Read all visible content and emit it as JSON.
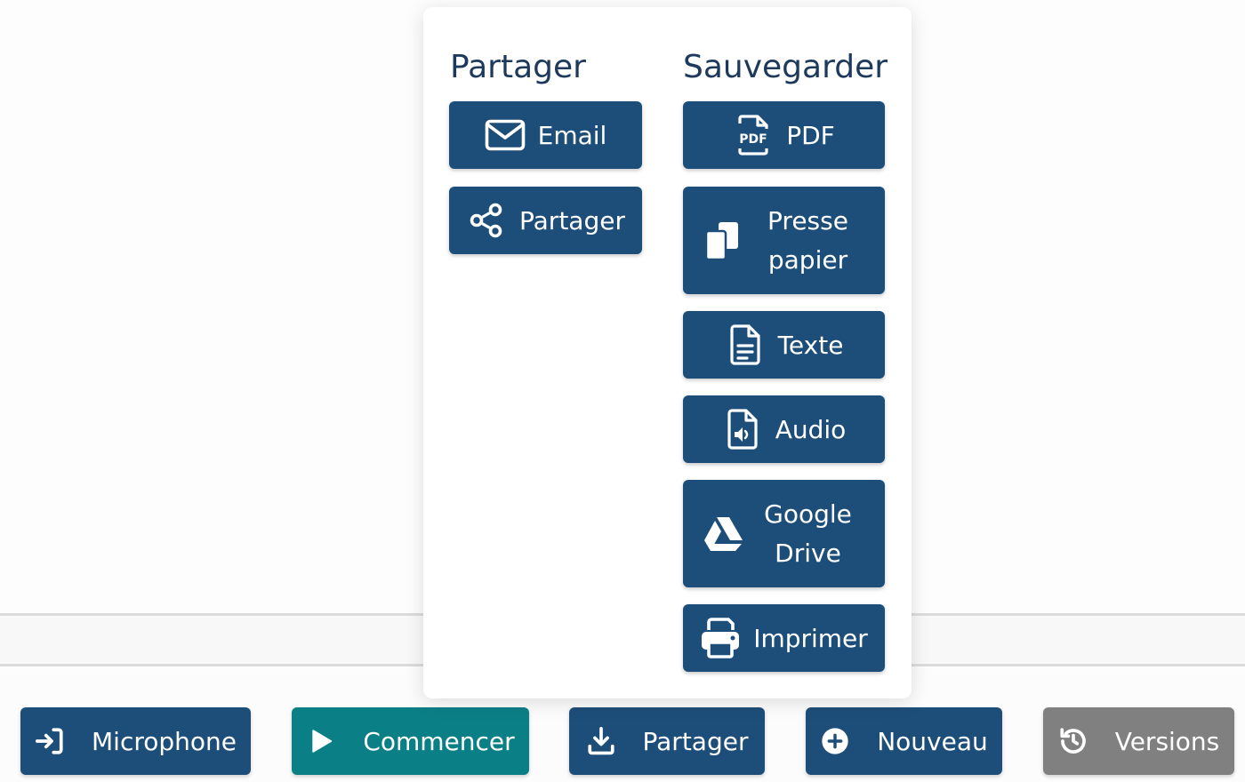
{
  "popover": {
    "share_column": {
      "title": "Partager",
      "buttons": [
        {
          "label": "Email",
          "icon": "envelope-icon"
        },
        {
          "label": "Partager",
          "icon": "share-nodes-icon"
        }
      ]
    },
    "save_column": {
      "title": "Sauvegarder",
      "buttons": [
        {
          "label": "PDF",
          "icon": "pdf-file-icon"
        },
        {
          "label": "Presse papier",
          "icon": "copy-icon"
        },
        {
          "label": "Texte",
          "icon": "text-file-icon"
        },
        {
          "label": "Audio",
          "icon": "audio-file-icon"
        },
        {
          "label": "Google Drive",
          "icon": "google-drive-icon"
        },
        {
          "label": "Imprimer",
          "icon": "printer-icon"
        }
      ]
    }
  },
  "toolbar": {
    "buttons": [
      {
        "label": "Microphone",
        "icon": "sign-in-icon",
        "color": "#1d4e79"
      },
      {
        "label": "Commencer",
        "icon": "play-icon",
        "color": "#0b7f86"
      },
      {
        "label": "Partager",
        "icon": "download-icon",
        "color": "#1d4e79"
      },
      {
        "label": "Nouveau",
        "icon": "plus-circle-icon",
        "color": "#1d4e79"
      },
      {
        "label": "Versions",
        "icon": "history-icon",
        "color": "#808080"
      }
    ]
  }
}
